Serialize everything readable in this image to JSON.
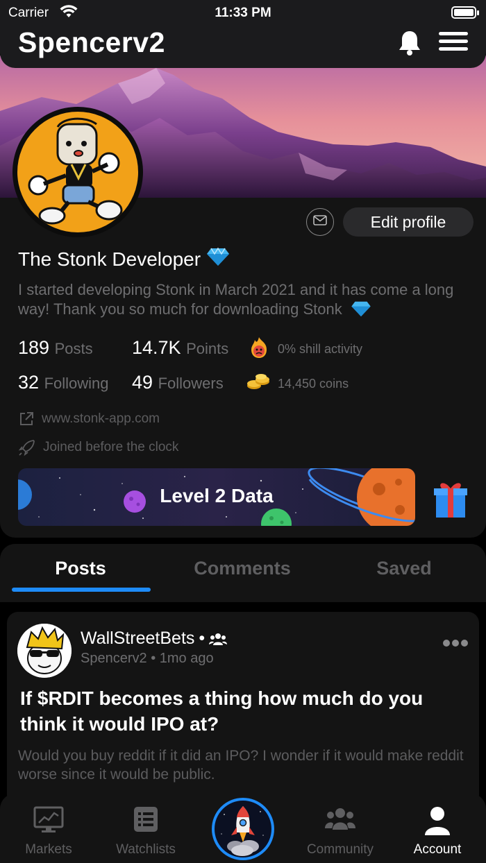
{
  "status_bar": {
    "carrier": "Carrier",
    "time": "11:33 PM"
  },
  "header": {
    "username": "Spencerv2"
  },
  "profile": {
    "display_name": "The Stonk Developer",
    "bio": "I started developing Stonk in March 2021 and it has come a long way! Thank you so much for downloading Stonk",
    "edit_profile_label": "Edit profile",
    "stats": {
      "posts_value": "189",
      "posts_label": "Posts",
      "points_value": "14.7K",
      "points_label": "Points",
      "following_value": "32",
      "following_label": "Following",
      "followers_value": "49",
      "followers_label": "Followers",
      "shill_activity": "0% shill activity",
      "coins": "14,450 coins"
    },
    "website": "www.stonk-app.com",
    "joined": "Joined before the clock",
    "level_banner": "Level 2 Data"
  },
  "tabs": [
    {
      "label": "Posts"
    },
    {
      "label": "Comments"
    },
    {
      "label": "Saved"
    }
  ],
  "post": {
    "community": "WallStreetBets",
    "separator": "•",
    "author": "Spencerv2",
    "age": "1mo ago",
    "title": "If $RDIT becomes a thing how much do you think it would IPO at?",
    "body": "Would you buy reddit if it did an IPO? I wonder if it would make reddit worse since it would be public."
  },
  "tabbar": [
    {
      "label": "Markets",
      "icon": "chart-monitor-icon"
    },
    {
      "label": "Watchlists",
      "icon": "list-icon"
    },
    {
      "label": "",
      "icon": "rocket-icon"
    },
    {
      "label": "Community",
      "icon": "group-icon"
    },
    {
      "label": "Account",
      "icon": "person-icon"
    }
  ],
  "colors": {
    "accent": "#1e8bf7",
    "card": "#141414",
    "header": "#1b1b1d",
    "muted_text": "#6e6e70",
    "avatar_bg": "#f2a118"
  }
}
